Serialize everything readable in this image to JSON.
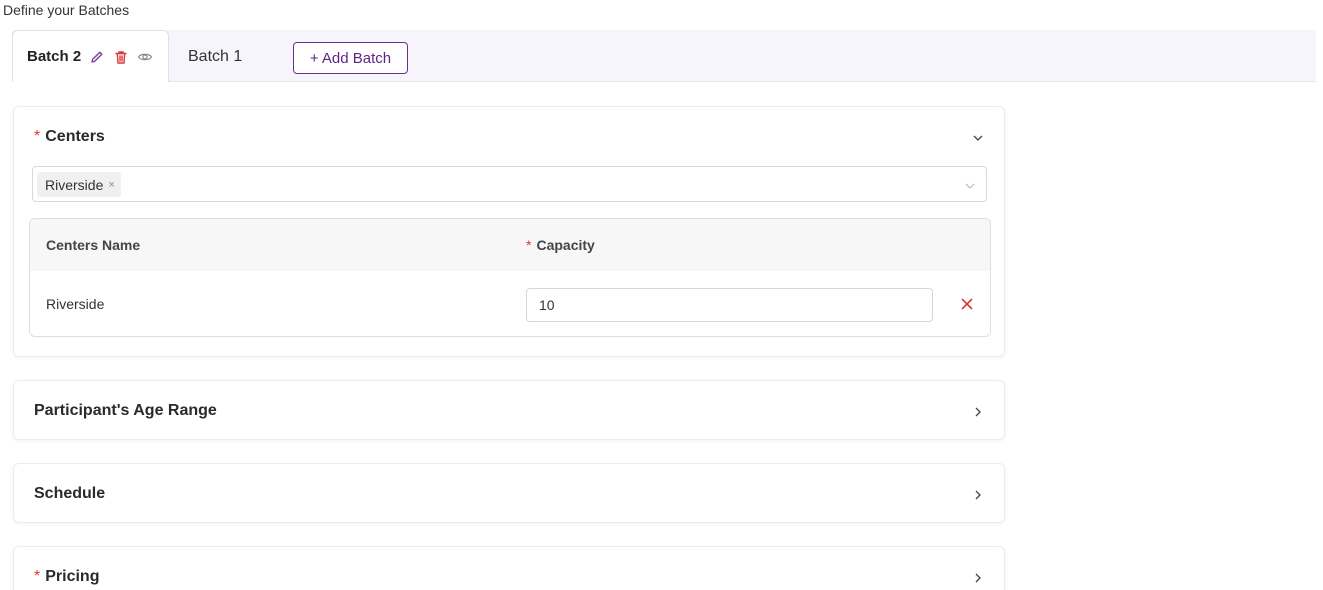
{
  "page": {
    "title": "Define your Batches"
  },
  "tabs": {
    "active": {
      "label": "Batch 2",
      "icons": [
        "edit-icon",
        "trash-icon",
        "eye-icon"
      ]
    },
    "inactive": [
      {
        "label": "Batch 1"
      }
    ],
    "add_button": "+ Add Batch"
  },
  "sections": {
    "centers": {
      "title": "Centers",
      "required_mark": "*",
      "expanded": true,
      "selected_tags": [
        {
          "label": "Riverside",
          "close": "×"
        }
      ],
      "table": {
        "columns": [
          "Centers Name",
          "Capacity"
        ],
        "capacity_required_mark": "*",
        "rows": [
          {
            "name": "Riverside",
            "capacity": "10"
          }
        ]
      }
    },
    "age_range": {
      "title": "Participant's Age Range",
      "expanded": false
    },
    "schedule": {
      "title": "Schedule",
      "expanded": false
    },
    "pricing": {
      "title": "Pricing",
      "required_mark": "*",
      "expanded": false
    }
  },
  "colors": {
    "accent": "#6b2f8e",
    "danger": "#d93838",
    "tabbar_bg": "#f6f5fb"
  }
}
